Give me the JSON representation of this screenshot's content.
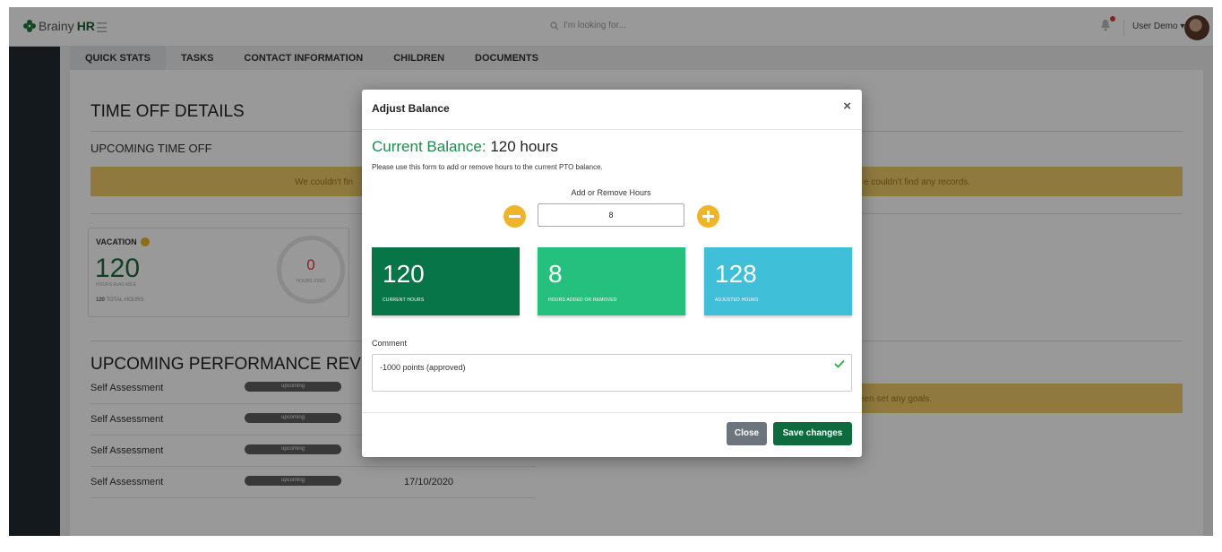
{
  "brand": {
    "name_prefix": "Brainy",
    "name_suffix": "HR"
  },
  "topbar": {
    "search_placeholder": "I'm looking for...",
    "user_name": "User Demo ▾",
    "icons": [
      "hamburger-icon",
      "search-icon",
      "bell-icon"
    ]
  },
  "tabs": [
    "QUICK STATS",
    "TASKS",
    "CONTACT INFORMATION",
    "CHILDREN",
    "DOCUMENTS"
  ],
  "background": {
    "time_off_title": "TIME OFF DETAILS",
    "upcoming_time_off": "UPCOMING TIME OFF",
    "alert_left": "We couldn't fin",
    "alert_right": "e couldn't find any records.",
    "vacation": {
      "title": "VACATION",
      "hours_available": "120",
      "hours_available_label": "HOURS AVAILABLE",
      "total_value": "120",
      "total_label": "TOTAL HOURS",
      "hours_used": "0",
      "hours_used_label": "HOURS USED"
    },
    "performance_title": "UPCOMING PERFORMANCE REVIE",
    "goals_alert": "een set any goals.",
    "reviews": [
      {
        "label": "Self Assessment",
        "status": "upcoming",
        "date": ""
      },
      {
        "label": "Self Assessment",
        "status": "upcoming",
        "date": ""
      },
      {
        "label": "Self Assessment",
        "status": "upcoming",
        "date": ""
      },
      {
        "label": "Self Assessment",
        "status": "upcoming",
        "date": "17/10/2020"
      }
    ]
  },
  "modal": {
    "title": "Adjust Balance",
    "close_symbol": "×",
    "current_balance_label": "Current Balance:",
    "current_balance_value": "120 hours",
    "description": "Please use this form to add or remove hours to the current PTO balance.",
    "adjust_label": "Add or Remove Hours",
    "adjust_value": "8",
    "stats": [
      {
        "value": "120",
        "label": "CURRENT HOURS"
      },
      {
        "value": "8",
        "label": "HOURS ADDED OR REMOVED"
      },
      {
        "value": "128",
        "label": "ADJUSTED HOURS"
      }
    ],
    "comment_label": "Comment",
    "comment_value": "-1000 points (approved)",
    "close_button": "Close",
    "save_button": "Save changes"
  },
  "colors": {
    "accent_green": "#0d6b3e",
    "balance_label_green": "#1f8a4c",
    "stat_current": "#077547",
    "stat_added": "#25c07d",
    "stat_adjusted": "#3fbfd8",
    "warning_yellow": "#efca6a",
    "plus_minus_yellow": "#f0b429",
    "sidebar": "#212a30"
  }
}
